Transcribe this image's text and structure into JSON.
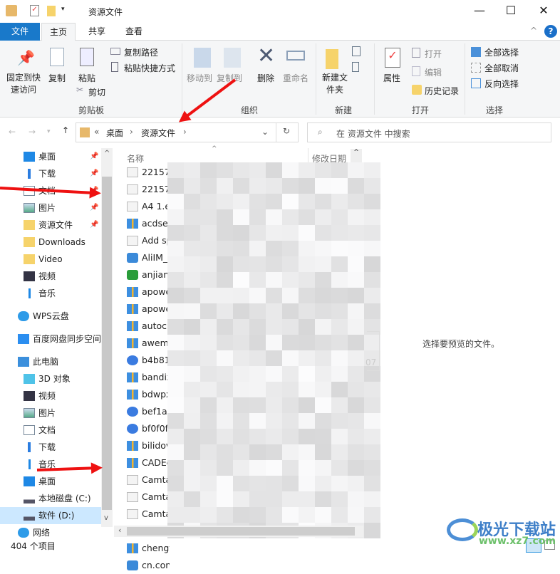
{
  "window": {
    "title": "资源文件",
    "minimize": "—",
    "maximize": "☐",
    "close": "✕"
  },
  "tabs": {
    "file": "文件",
    "home": "主页",
    "share": "共享",
    "view": "查看",
    "help": "?"
  },
  "ribbon": {
    "clipboard": {
      "label": "剪贴板",
      "pin": "固定到快速访问",
      "copy": "复制",
      "paste": "粘贴",
      "copy_path": "复制路径",
      "paste_shortcut": "粘贴快捷方式",
      "cut": "剪切"
    },
    "organize": {
      "label": "组织",
      "move_to": "移动到",
      "copy_to": "复制到",
      "delete": "删除",
      "rename": "重命名"
    },
    "new": {
      "label": "新建",
      "new_folder": "新建文件夹"
    },
    "open": {
      "label": "打开",
      "properties": "属性",
      "open": "打开",
      "edit": "编辑",
      "history": "历史记录"
    },
    "select": {
      "label": "选择",
      "select_all": "全部选择",
      "select_none": "全部取消",
      "invert": "反向选择"
    }
  },
  "address": {
    "overflow": "«",
    "crumbs": [
      "桌面",
      "资源文件"
    ],
    "search_placeholder": "在 资源文件 中搜索"
  },
  "nav": {
    "quick": [
      {
        "label": "桌面",
        "icon": "desktop-icon",
        "pinned": true
      },
      {
        "label": "下载",
        "icon": "download-icon",
        "pinned": true
      },
      {
        "label": "文档",
        "icon": "document-icon",
        "pinned": true
      },
      {
        "label": "图片",
        "icon": "picture-icon",
        "pinned": true
      },
      {
        "label": "资源文件",
        "icon": "folder-icon",
        "pinned": true
      },
      {
        "label": "Downloads",
        "icon": "folder-icon"
      },
      {
        "label": "Video",
        "icon": "folder-icon"
      },
      {
        "label": "视频",
        "icon": "video-icon"
      },
      {
        "label": "音乐",
        "icon": "music-icon"
      }
    ],
    "wps": "WPS云盘",
    "baidu": "百度网盘同步空间",
    "pc": "此电脑",
    "pc_items": [
      {
        "label": "3D 对象",
        "icon": "3d-objects-icon"
      },
      {
        "label": "视频",
        "icon": "video-icon"
      },
      {
        "label": "图片",
        "icon": "picture-icon"
      },
      {
        "label": "文档",
        "icon": "document-icon"
      },
      {
        "label": "下载",
        "icon": "download-icon"
      },
      {
        "label": "音乐",
        "icon": "music-icon"
      },
      {
        "label": "桌面",
        "icon": "desktop-icon"
      },
      {
        "label": "本地磁盘 (C:)",
        "icon": "drive-icon"
      },
      {
        "label": "软件 (D:)",
        "icon": "drive-icon",
        "selected": true
      }
    ],
    "network": "网络"
  },
  "list": {
    "col_name": "名称",
    "col_date": "修改日期",
    "partial_text": "07",
    "files": [
      {
        "name": "22157",
        "icon": "mail"
      },
      {
        "name": "22157",
        "icon": "mail"
      },
      {
        "name": "A4 1.e",
        "icon": "mail"
      },
      {
        "name": "acdse",
        "icon": "archive"
      },
      {
        "name": "Add sp",
        "icon": "mail"
      },
      {
        "name": "AliIM_",
        "icon": "app"
      },
      {
        "name": "anjianj",
        "icon": "app-green"
      },
      {
        "name": "apowe",
        "icon": "archive"
      },
      {
        "name": "apowe",
        "icon": "archive"
      },
      {
        "name": "autocb",
        "icon": "archive"
      },
      {
        "name": "aweme",
        "icon": "archive"
      },
      {
        "name": "b4b81",
        "icon": "jpg"
      },
      {
        "name": "bandiz",
        "icon": "archive"
      },
      {
        "name": "bdwpx",
        "icon": "archive"
      },
      {
        "name": "bef1a6",
        "icon": "jpg"
      },
      {
        "name": "bf0f0f",
        "icon": "jpg"
      },
      {
        "name": "bilidov",
        "icon": "archive"
      },
      {
        "name": "CADEd",
        "icon": "archive"
      },
      {
        "name": "Camta",
        "icon": "mail"
      },
      {
        "name": "Camta",
        "icon": "mail"
      },
      {
        "name": "Camta",
        "icon": "mail"
      },
      {
        "name": "Camta",
        "icon": "mail"
      },
      {
        "name": "chengt",
        "icon": "archive"
      },
      {
        "name": "cn.con",
        "icon": "app"
      }
    ]
  },
  "preview": {
    "message": "选择要预览的文件。"
  },
  "status": {
    "count": "404 个项目"
  },
  "watermark": {
    "name": "极光下载站",
    "url": "www.xz7.com"
  },
  "colors": {
    "accent": "#1979ca",
    "annotation": "#e11111"
  }
}
